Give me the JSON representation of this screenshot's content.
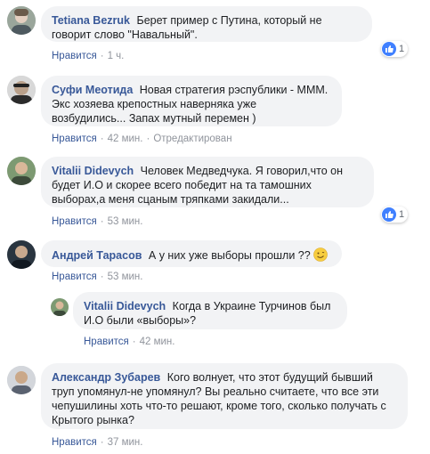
{
  "comments": [
    {
      "author": "Tetiana Bezruk",
      "text": "Берет пример с Путина, который не говорит слово \"Навальный\".",
      "like": "Нравится",
      "time": "1 ч.",
      "reactions": "1",
      "avatar_color": "#7a8a7c"
    },
    {
      "author": "Суфи Меотида",
      "text": "Новая стратегия рэспублики - МММ. Экс хозяева крепостных наверняка уже возбудились... Запах мутный перемен )",
      "like": "Нравится",
      "time": "42 мин.",
      "edited": "Отредактирован",
      "avatar_color": "#2d2d2d"
    },
    {
      "author": "Vitalii Didevych",
      "text": "Человек Медведчука. Я говорил,что он будет И.О и скорее всего победит на та тамошних выборах,а меня сцаным тряпками закидали...",
      "like": "Нравится",
      "time": "53 мин.",
      "reactions": "1",
      "avatar_color": "#5e7d5a"
    },
    {
      "author": "Андрей Тарасов",
      "text": "А у них уже выборы прошли ??",
      "like": "Нравится",
      "time": "53 мин.",
      "avatar_color": "#1f2a33"
    },
    {
      "author": "Vitalii Didevych",
      "text": "Когда в Украине Турчинов был И.О были «выборы»?",
      "like": "Нравится",
      "time": "42 мин.",
      "avatar_color": "#5e7d5a"
    },
    {
      "author": "Александр Зубарев",
      "text": "Кого волнует, что этот будущий бывший труп упомянул-не упомянул? Вы реально считаете, что все эти чепушилины хоть что-то решают, кроме того, сколько получать с Крытого рынка?",
      "like": "Нравится",
      "time": "37 мин.",
      "avatar_color": "#8b9099"
    }
  ],
  "separator": "·",
  "colors": {
    "author": "#385898",
    "bubble": "#f2f3f5",
    "like_icon": "#4080ff",
    "meta": "#90949c"
  }
}
